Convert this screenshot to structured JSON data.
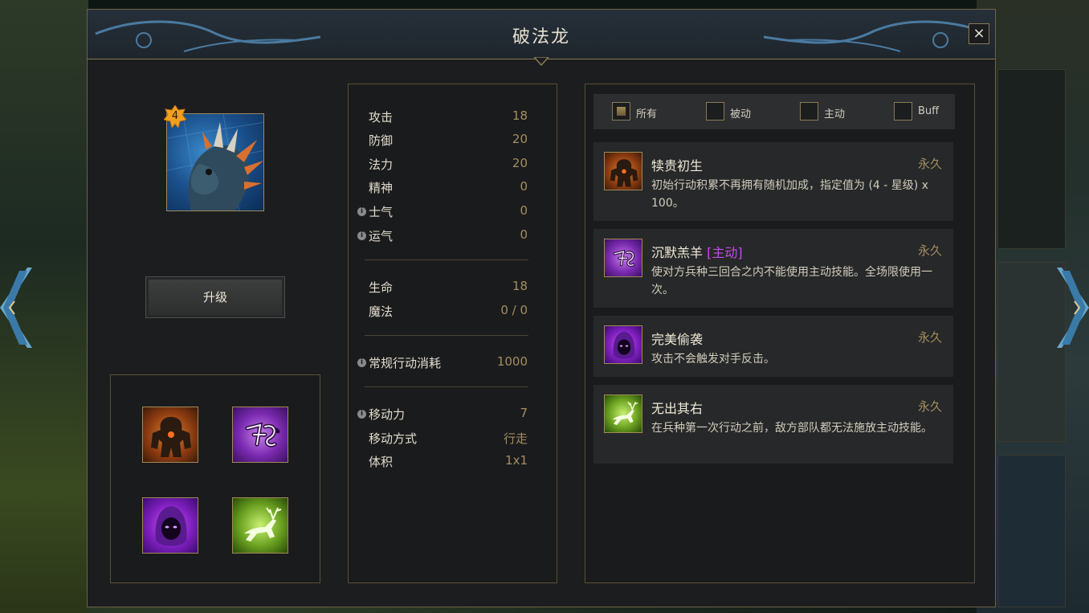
{
  "window": {
    "title": "破法龙",
    "close_label": "×"
  },
  "unit": {
    "star_level": "4",
    "upgrade_label": "升级"
  },
  "stats": {
    "attack": {
      "label": "攻击",
      "value": "18"
    },
    "defense": {
      "label": "防御",
      "value": "20"
    },
    "magic_power": {
      "label": "法力",
      "value": "20"
    },
    "spirit": {
      "label": "精神",
      "value": "0"
    },
    "morale": {
      "label": "士气",
      "value": "0"
    },
    "luck": {
      "label": "运气",
      "value": "0"
    },
    "health": {
      "label": "生命",
      "value": "18"
    },
    "mana": {
      "label": "魔法",
      "value": "0 / 0"
    },
    "action_cost": {
      "label": "常规行动消耗",
      "value": "1000"
    },
    "movement": {
      "label": "移动力",
      "value": "7"
    },
    "move_type": {
      "label": "移动方式",
      "value": "行走"
    },
    "size": {
      "label": "体积",
      "value": "1x1"
    },
    "info_glyph": "i"
  },
  "filters": [
    {
      "label": "所有",
      "checked": true
    },
    {
      "label": "被动",
      "checked": false
    },
    {
      "label": "主动",
      "checked": false
    },
    {
      "label": "Buff",
      "checked": false
    }
  ],
  "abilities": [
    {
      "name": "犊贵初生",
      "tag": "",
      "duration": "永久",
      "description": "初始行动积累不再拥有随机加成，指定值为 (4 - 星级) x 100。",
      "icon": "golem-icon"
    },
    {
      "name": "沉默羔羊",
      "tag": "[主动]",
      "duration": "永久",
      "description": "使对方兵种三回合之内不能使用主动技能。全场限使用一次。",
      "icon": "silence-rune-icon"
    },
    {
      "name": "完美偷袭",
      "tag": "",
      "duration": "永久",
      "description": "攻击不会触发对手反击。",
      "icon": "hooded-figure-icon"
    },
    {
      "name": "无出其右",
      "tag": "",
      "duration": "永久",
      "description": "在兵种第一次行动之前，敌方部队都无法施放主动技能。",
      "icon": "leaping-deer-icon"
    }
  ],
  "colors": {
    "gold_border": "#8a7a55",
    "value_gold": "#a58e62",
    "active_tag": "#c84ae8",
    "star_badge": "#f0a020"
  }
}
